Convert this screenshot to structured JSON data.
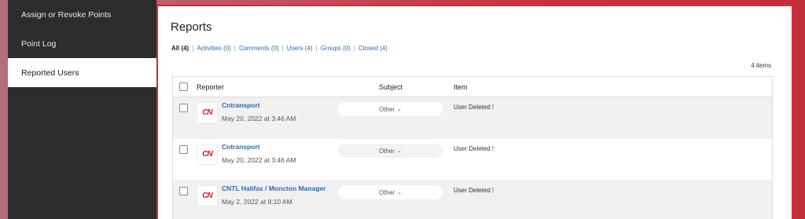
{
  "sidebar": {
    "items": [
      {
        "label": "Assign or Revoke Points"
      },
      {
        "label": "Point Log"
      },
      {
        "label": "Reported Users"
      }
    ]
  },
  "main": {
    "title": "Reports",
    "filters": [
      {
        "label": "All (4)"
      },
      {
        "label": "Activities (0)"
      },
      {
        "label": "Comments (0)"
      },
      {
        "label": "Users (4)"
      },
      {
        "label": "Groups (0)"
      },
      {
        "label": "Closed (4)"
      }
    ],
    "separator": "|",
    "item_count": "4 items",
    "table": {
      "headers": {
        "reporter": "Reporter",
        "subject": "Subject",
        "item": "Item"
      },
      "rows": [
        {
          "avatar": "CN",
          "name": "Cntransport",
          "date": "May 20, 2022 at 3:46 AM",
          "subject": "Other",
          "item": "User Deleted !"
        },
        {
          "avatar": "CN",
          "name": "Cntransport",
          "date": "May 20, 2022 at 3:46 AM",
          "subject": "Other",
          "item": "User Deleted !"
        },
        {
          "avatar": "CN",
          "name": "CNTL Halifax / Moncton Manager",
          "date": "May 2, 2022 at 8:10 AM",
          "subject": "Other",
          "item": "User Deleted !"
        }
      ]
    }
  },
  "colors": {
    "accent_border": "#d42a36",
    "link": "#2e6aa8",
    "sidebar_bg": "#2c2c2c",
    "logo_red": "#d0202a"
  },
  "icons": {
    "subject_dropdown": "chevron-down-icon",
    "avatar_logo": "cn-logo"
  }
}
